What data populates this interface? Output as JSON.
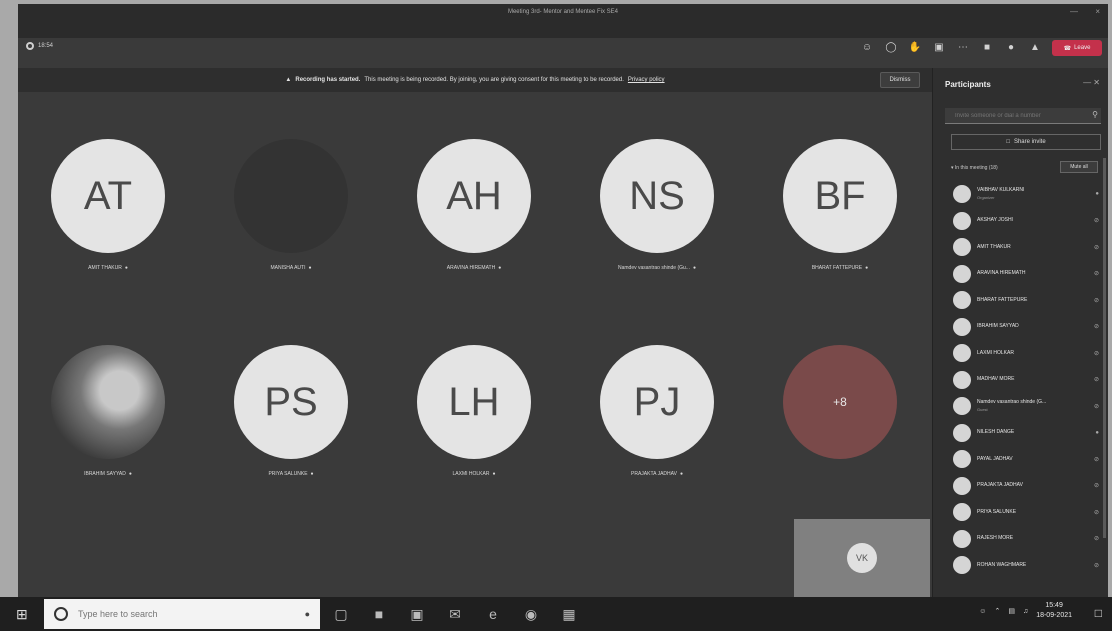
{
  "window": {
    "title": "Meeting 3rd- Mentor and Mentee Fix SE4",
    "minimize": "—",
    "close": "×"
  },
  "meeting": {
    "timer": "18:54"
  },
  "toolbar": {
    "icons": [
      "participants-icon",
      "chat-icon",
      "reactions-icon",
      "rooms-icon",
      "more-icon",
      "camera-icon",
      "mic-icon",
      "share-icon"
    ],
    "leave_label": "Leave"
  },
  "banner": {
    "bold": "Recording has started.",
    "text": "This meeting is being recorded. By joining, you are giving consent for this meeting to be recorded.",
    "link": "Privacy policy",
    "dismiss": "Dismiss"
  },
  "tiles": [
    {
      "initials": "AT",
      "name": "AMIT THAKUR"
    },
    {
      "initials": "",
      "name": "MANISHA AUTI"
    },
    {
      "initials": "AH",
      "name": "ARAVINA HIREMATH"
    },
    {
      "initials": "NS",
      "name": "Namdev vasantrao shinde (Gu..."
    },
    {
      "initials": "BF",
      "name": "BHARAT FATTEPURE"
    },
    {
      "initials": "",
      "name": "IBRAHIM SAYYAD"
    },
    {
      "initials": "PS",
      "name": "PRIYA SALUNKE"
    },
    {
      "initials": "LH",
      "name": "LAXMI HOLKAR"
    },
    {
      "initials": "PJ",
      "name": "PRAJAKTA JADHAV"
    },
    {
      "initials": "+8",
      "name": ""
    }
  ],
  "self_view": {
    "initials": "VK"
  },
  "panel": {
    "title": "Participants",
    "invite_placeholder": "Invite someone or dial a number",
    "share_invite": "Share invite",
    "in_meeting": "In this meeting (18)",
    "mute_all": "Mute all",
    "participants": [
      {
        "name": "VAIBHAV KULKARNI",
        "sub": "Organizer"
      },
      {
        "name": "AKSHAY JOSHI",
        "sub": ""
      },
      {
        "name": "AMIT THAKUR",
        "sub": ""
      },
      {
        "name": "ARAVINA HIREMATH",
        "sub": ""
      },
      {
        "name": "BHARAT FATTEPURE",
        "sub": ""
      },
      {
        "name": "IBRAHIM SAYYAD",
        "sub": ""
      },
      {
        "name": "LAXMI HOLKAR",
        "sub": ""
      },
      {
        "name": "MADHAV MORE",
        "sub": ""
      },
      {
        "name": "Namdev vasantrao shinde (G...",
        "sub": "Guest"
      },
      {
        "name": "NILESH DANGE",
        "sub": ""
      },
      {
        "name": "PAYAL JADHAV",
        "sub": ""
      },
      {
        "name": "PRAJAKTA JADHAV",
        "sub": ""
      },
      {
        "name": "PRIYA SALUNKE",
        "sub": ""
      },
      {
        "name": "RAJESH MORE",
        "sub": ""
      },
      {
        "name": "ROHAN WAGHMARE",
        "sub": ""
      }
    ]
  },
  "taskbar": {
    "search_placeholder": "Type here to search",
    "time": "15:49",
    "date": "18-09-2021"
  }
}
